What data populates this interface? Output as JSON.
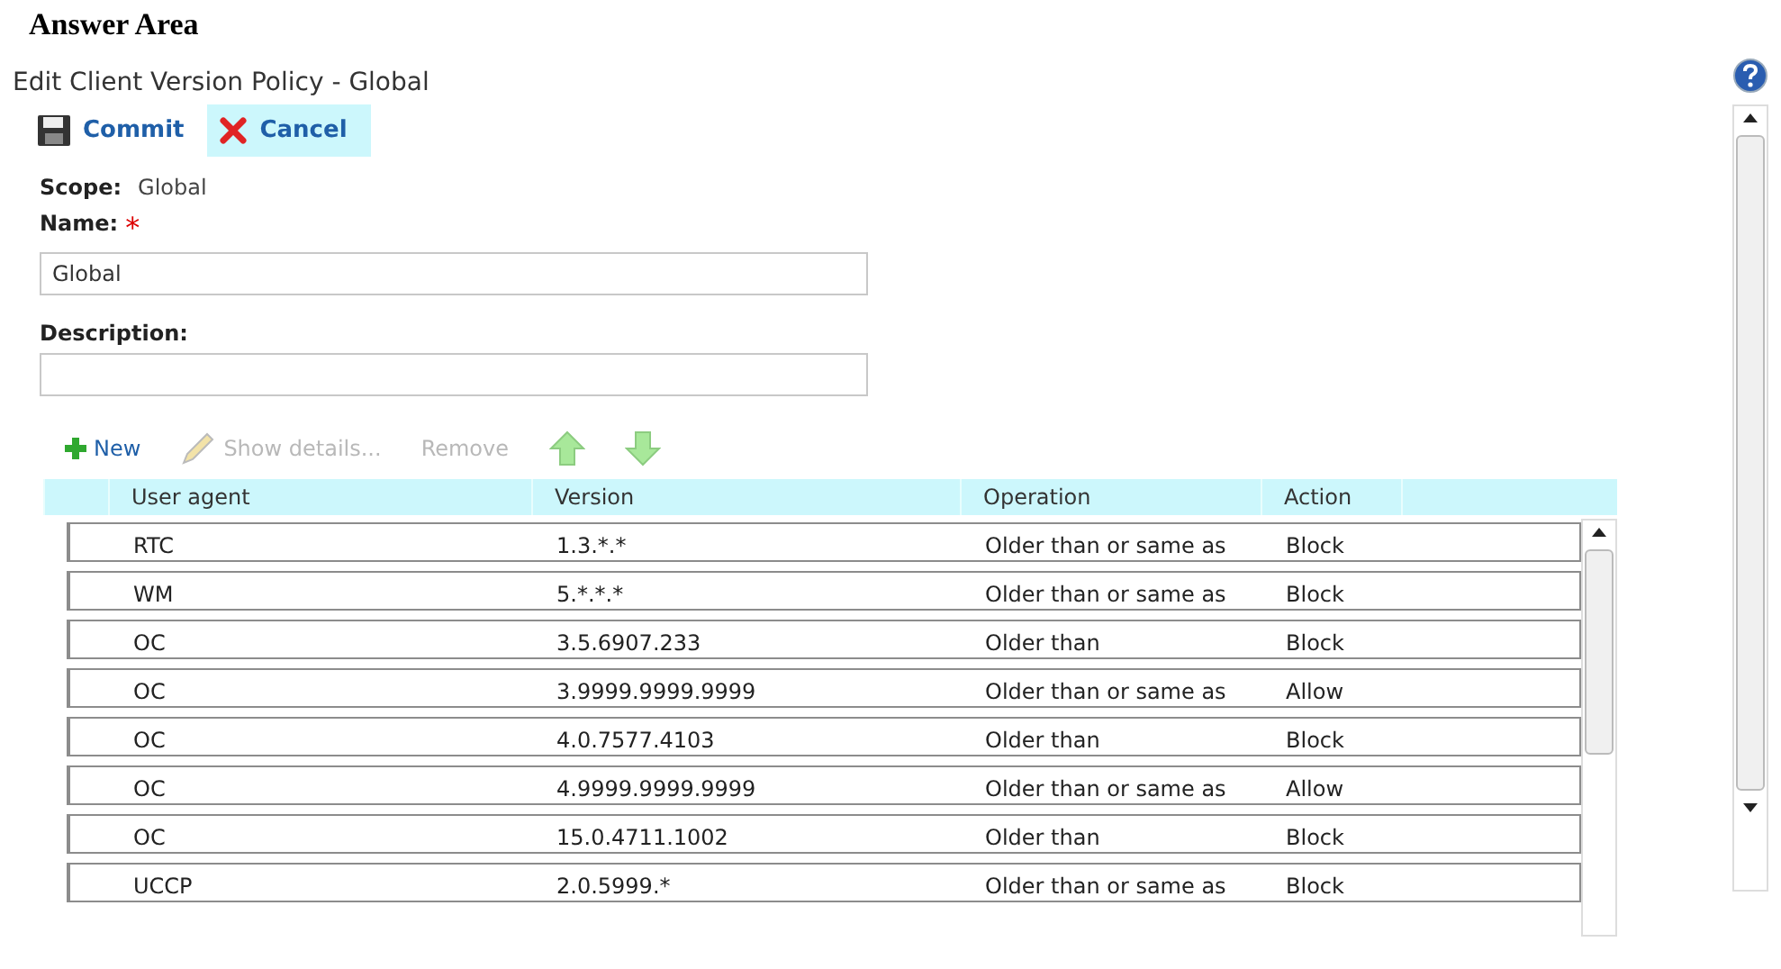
{
  "heading": "Answer Area",
  "title": "Edit Client Version Policy - Global",
  "actions": [
    {
      "kind": "commit",
      "label": "Commit",
      "highlighted": false
    },
    {
      "kind": "cancel",
      "label": "Cancel",
      "highlighted": true
    }
  ],
  "scope": {
    "label": "Scope:",
    "value": "Global"
  },
  "name": {
    "label": "Name:",
    "required": "*",
    "value": "Global"
  },
  "description": {
    "label": "Description:"
  },
  "rule_toolbar": [
    {
      "kind": "new",
      "label": "New",
      "disabled": false
    },
    {
      "kind": "edit",
      "label": "Show details...",
      "disabled": true
    },
    {
      "kind": "remove",
      "label": "Remove",
      "disabled": true
    },
    {
      "kind": "up",
      "disabled": false
    },
    {
      "kind": "down",
      "disabled": false
    }
  ],
  "table": {
    "columns": [
      "User agent",
      "Version",
      "Operation",
      "Action"
    ],
    "rows": [
      [
        "RTC",
        "1.3.*.*",
        "Older than or same as",
        "Block"
      ],
      [
        "WM",
        "5.*.*.*",
        "Older than or same as",
        "Block"
      ],
      [
        "OC",
        "3.5.6907.233",
        "Older than",
        "Block"
      ],
      [
        "OC",
        "3.9999.9999.9999",
        "Older than or same as",
        "Allow"
      ],
      [
        "OC",
        "4.0.7577.4103",
        "Older than",
        "Block"
      ],
      [
        "OC",
        "4.9999.9999.9999",
        "Older than or same as",
        "Allow"
      ],
      [
        "OC",
        "15.0.4711.1002",
        "Older than",
        "Block"
      ],
      [
        "UCCP",
        "2.0.5999.*",
        "Older than or same as",
        "Block"
      ]
    ]
  }
}
